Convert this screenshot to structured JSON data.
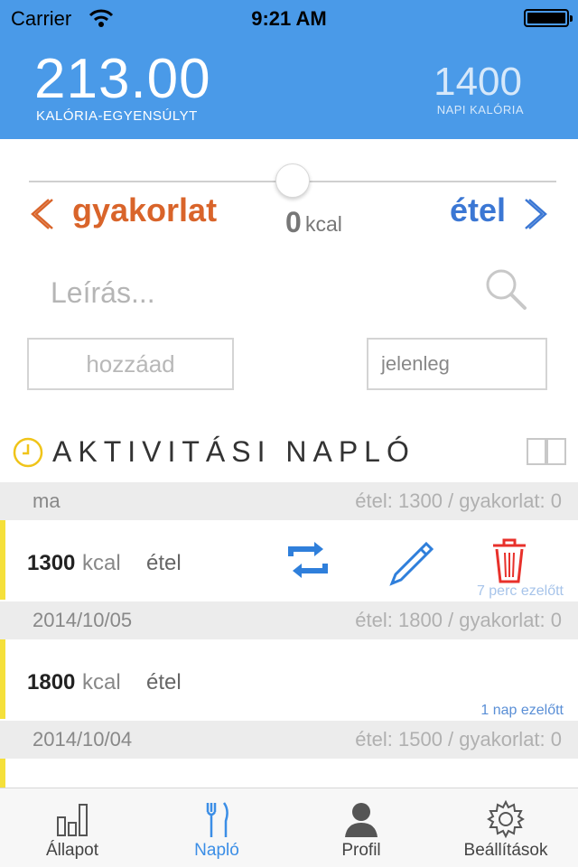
{
  "status_bar": {
    "carrier": "Carrier",
    "time": "9:21 AM"
  },
  "header": {
    "balance": "213.00",
    "balance_label": "KALÓRIA-EGYENSÚLYT",
    "daily_calories": "1400",
    "daily_label": "NAPI KALÓRIA"
  },
  "slider": {
    "value_fraction": 0.5
  },
  "selector": {
    "left_label": "gyakorlat",
    "right_label": "étel",
    "kcal_value": "0",
    "kcal_unit": "kcal"
  },
  "search": {
    "placeholder": "Leírás..."
  },
  "inputs": {
    "add_placeholder": "hozzáad",
    "time_value": "jelenleg"
  },
  "log": {
    "title": "AKTIVITÁSI NAPLÓ",
    "days": [
      {
        "date": "ma",
        "summary": "étel: 1300 / gyakorlat: 0",
        "entry": {
          "kcal": "1300",
          "unit": "kcal",
          "type": "étel",
          "ago": "7 perc ezelőtt"
        }
      },
      {
        "date": "2014/10/05",
        "summary": "étel: 1800 / gyakorlat: 0",
        "entry": {
          "kcal": "1800",
          "unit": "kcal",
          "type": "étel",
          "ago": "1 nap ezelőtt"
        }
      },
      {
        "date": "2014/10/04",
        "summary": "étel: 1500 / gyakorlat: 0"
      }
    ]
  },
  "tabs": [
    {
      "label": "Állapot",
      "icon": "chart-icon",
      "active": false
    },
    {
      "label": "Napló",
      "icon": "fork-knife-icon",
      "active": true
    },
    {
      "label": "Profil",
      "icon": "person-icon",
      "active": false
    },
    {
      "label": "Beállítások",
      "icon": "gear-icon",
      "active": false
    }
  ],
  "colors": {
    "header_bg": "#4a9ae8",
    "exercise": "#d9642a",
    "food": "#3b77d4",
    "delete": "#e8312b",
    "entry_marker": "#f5e03a"
  }
}
